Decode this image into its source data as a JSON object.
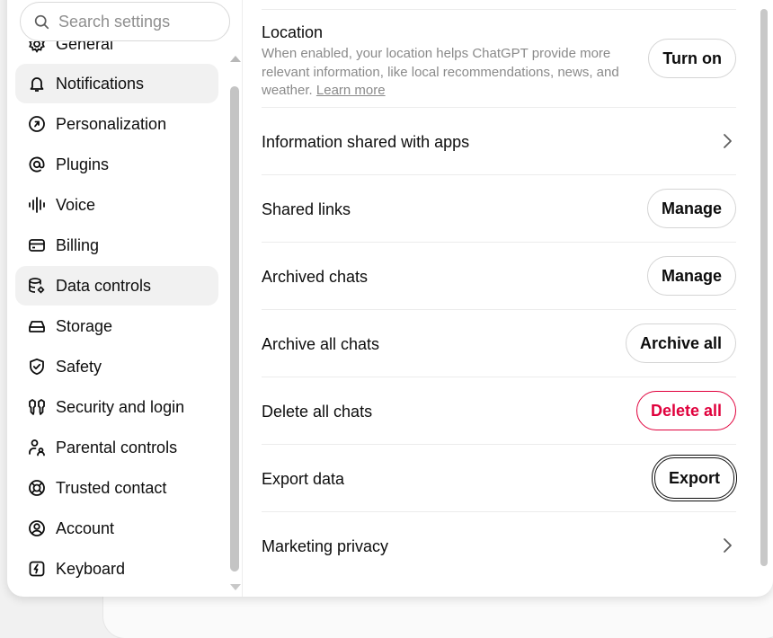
{
  "search": {
    "placeholder": "Search settings"
  },
  "sidebar": {
    "items": [
      {
        "label": "General",
        "icon": "gear-icon"
      },
      {
        "label": "Notifications",
        "icon": "bell-icon"
      },
      {
        "label": "Personalization",
        "icon": "personalization-icon"
      },
      {
        "label": "Plugins",
        "icon": "at-icon"
      },
      {
        "label": "Voice",
        "icon": "waveform-icon"
      },
      {
        "label": "Billing",
        "icon": "credit-card-icon"
      },
      {
        "label": "Data controls",
        "icon": "database-gear-icon"
      },
      {
        "label": "Storage",
        "icon": "storage-icon"
      },
      {
        "label": "Safety",
        "icon": "shield-check-icon"
      },
      {
        "label": "Security and login",
        "icon": "security-icon"
      },
      {
        "label": "Parental controls",
        "icon": "parent-icon"
      },
      {
        "label": "Trusted contact",
        "icon": "lifebuoy-icon"
      },
      {
        "label": "Account",
        "icon": "user-circle-icon"
      },
      {
        "label": "Keyboard",
        "icon": "keyboard-icon"
      }
    ]
  },
  "content": {
    "location": {
      "title": "Location",
      "description": "When enabled, your location helps ChatGPT provide more relevant information, like local recommendations, news, and weather.",
      "learn_more": "Learn more",
      "button": "Turn on"
    },
    "info_shared": {
      "title": "Information shared with apps"
    },
    "shared_links": {
      "title": "Shared links",
      "button": "Manage"
    },
    "archived_chats": {
      "title": "Archived chats",
      "button": "Manage"
    },
    "archive_all": {
      "title": "Archive all chats",
      "button": "Archive all"
    },
    "delete_all": {
      "title": "Delete all chats",
      "button": "Delete all"
    },
    "export_data": {
      "title": "Export data",
      "button": "Export"
    },
    "marketing_privacy": {
      "title": "Marketing privacy"
    }
  },
  "colors": {
    "danger": "#e0003c",
    "active_bg": "#f1f1f1",
    "muted_text": "#8a8a8a"
  }
}
